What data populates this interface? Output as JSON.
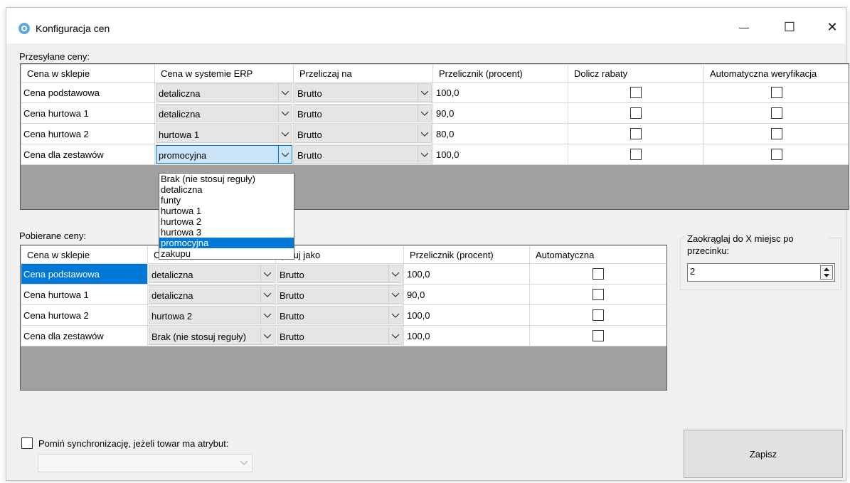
{
  "window": {
    "title": "Konfiguracja cen",
    "minimize": "—",
    "maximize": "☐",
    "close": "✕"
  },
  "sent": {
    "label": "Przesyłane ceny:",
    "headers": [
      "Cena w sklepie",
      "Cena w systemie ERP",
      "Przeliczaj na",
      "Przelicznik (procent)",
      "Dolicz rabaty",
      "Automatyczna weryfikacja"
    ],
    "rows": [
      {
        "shop": "Cena podstawowa",
        "erp": "detaliczna",
        "conv": "Brutto",
        "factor": "100,0",
        "discount": false,
        "verify": false
      },
      {
        "shop": "Cena hurtowa 1",
        "erp": "detaliczna",
        "conv": "Brutto",
        "factor": "90,0",
        "discount": false,
        "verify": false
      },
      {
        "shop": "Cena hurtowa 2",
        "erp": "hurtowa 1",
        "conv": "Brutto",
        "factor": "80,0",
        "discount": false,
        "verify": false
      },
      {
        "shop": "Cena dla zestawów",
        "erp": "promocyjna",
        "conv": "Brutto",
        "factor": "100,0",
        "discount": false,
        "verify": false
      }
    ]
  },
  "dropdown": {
    "options": [
      "Brak (nie stosuj reguły)",
      "detaliczna",
      "funty",
      "hurtowa 1",
      "hurtowa 2",
      "hurtowa 3",
      "promocyjna",
      "zakupu"
    ],
    "selected": "promocyjna"
  },
  "received": {
    "label": "Pobierane ceny:",
    "headers": [
      "Cena w sklepie",
      "C",
      "pisuj jako",
      "Przelicznik (procent)",
      "Automatyczna"
    ],
    "rows": [
      {
        "shop": "Cena podstawowa",
        "erp": "detaliczna",
        "conv": "Brutto",
        "factor": "100,0",
        "auto": false
      },
      {
        "shop": "Cena hurtowa 1",
        "erp": "detaliczna",
        "conv": "Brutto",
        "factor": "90,0",
        "auto": false
      },
      {
        "shop": "Cena hurtowa 2",
        "erp": "hurtowa 2",
        "conv": "Brutto",
        "factor": "100,0",
        "auto": false
      },
      {
        "shop": "Cena dla zestawów",
        "erp": "Brak (nie stosuj reguły)",
        "conv": "Brutto",
        "factor": "100,0",
        "auto": false
      }
    ]
  },
  "rounding": {
    "legend": "Zaokrąglaj do X miejsc po przecinku:",
    "value": "2"
  },
  "skip_sync": {
    "label": "Pomiń synchronizację, jeżeli towar ma atrybut:",
    "checked": false,
    "attribute_value": ""
  },
  "save_button": "Zapisz",
  "colors": {
    "selection": "#0078d7",
    "combo_bg": "#e5e5e5",
    "grid_empty": "#a0a0a0",
    "window_bg": "#f0f0f0"
  }
}
